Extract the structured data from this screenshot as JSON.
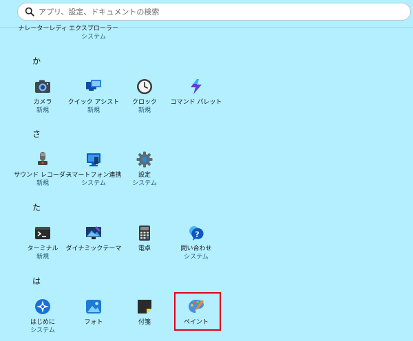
{
  "search": {
    "placeholder": "アプリ、設定、ドキュメントの検索"
  },
  "partial_row": [
    {
      "name": "ナレーターレディ",
      "sub": ""
    },
    {
      "name": "エクスプローラー",
      "sub": "システム"
    }
  ],
  "sections": [
    {
      "header": "か",
      "apps": [
        {
          "name": "カメラ",
          "sub": "新規",
          "icon": "camera-icon"
        },
        {
          "name": "クイック アシスト",
          "sub": "新規",
          "icon": "quick-assist-icon"
        },
        {
          "name": "クロック",
          "sub": "新規",
          "icon": "clock-icon"
        },
        {
          "name": "コマンド パレット",
          "sub": "",
          "icon": "command-palette-icon"
        }
      ]
    },
    {
      "header": "さ",
      "apps": [
        {
          "name": "サウンド レコーダー",
          "sub": "新規",
          "icon": "sound-recorder-icon"
        },
        {
          "name": "スマートフォン連携",
          "sub": "システム",
          "icon": "phone-link-icon"
        },
        {
          "name": "設定",
          "sub": "システム",
          "icon": "settings-gear-icon"
        }
      ]
    },
    {
      "header": "た",
      "apps": [
        {
          "name": "ターミナル",
          "sub": "新規",
          "icon": "terminal-icon"
        },
        {
          "name": "ダイナミックテーマ",
          "sub": "",
          "icon": "dynamic-theme-icon"
        },
        {
          "name": "電卓",
          "sub": "",
          "icon": "calculator-icon"
        },
        {
          "name": "問い合わせ",
          "sub": "システム",
          "icon": "get-help-icon"
        }
      ]
    },
    {
      "header": "は",
      "apps": [
        {
          "name": "はじめに",
          "sub": "システム",
          "icon": "get-started-icon"
        },
        {
          "name": "フォト",
          "sub": "",
          "icon": "photos-icon"
        },
        {
          "name": "付箋",
          "sub": "",
          "icon": "sticky-notes-icon"
        },
        {
          "name": "ペイント",
          "sub": "",
          "icon": "paint-palette-icon"
        }
      ]
    }
  ],
  "highlight_color": "#e0001a",
  "background_color": "#b3efff"
}
